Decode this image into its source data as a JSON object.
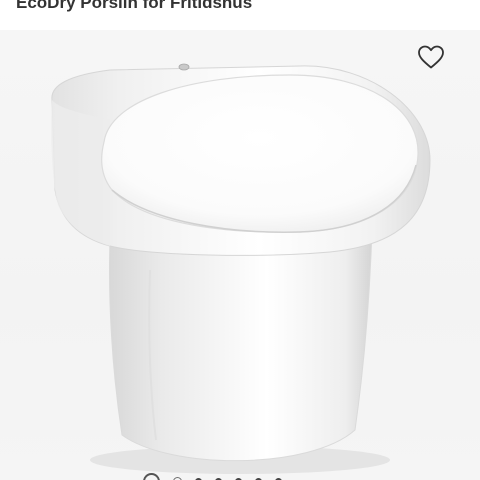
{
  "product": {
    "title": "EcoDry Porslin for Fritidshus"
  },
  "gallery": {
    "favorite_icon": "heart-outline-icon",
    "image_subject": "toilet-product-photo",
    "dots": 7,
    "active_dot": 0
  },
  "colors": {
    "title": "#333333",
    "icon": "#333333",
    "background": "#ffffff"
  }
}
